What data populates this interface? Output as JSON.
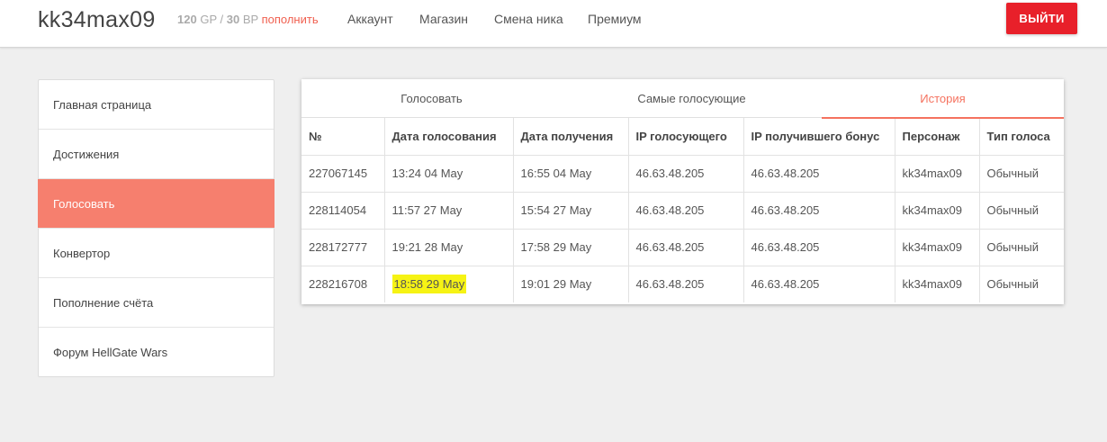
{
  "header": {
    "username": "kk34max09",
    "gp_value": "120",
    "gp_unit": "GP",
    "separator": "/",
    "bp_value": "30",
    "bp_unit": "BP",
    "topup_label": "пополнить",
    "nav": [
      "Аккаунт",
      "Магазин",
      "Смена ника",
      "Премиум"
    ],
    "logout_label": "ВЫЙТИ"
  },
  "sidebar": {
    "items": [
      {
        "label": "Главная страница",
        "active": false
      },
      {
        "label": "Достижения",
        "active": false
      },
      {
        "label": "Голосовать",
        "active": true
      },
      {
        "label": "Конвертор",
        "active": false
      },
      {
        "label": "Пополнение счёта",
        "active": false
      },
      {
        "label": "Форум HellGate Wars",
        "active": false
      }
    ]
  },
  "tabs": [
    {
      "label": "Голосовать",
      "active": false
    },
    {
      "label": "Самые голосующие",
      "active": false
    },
    {
      "label": "История",
      "active": true
    }
  ],
  "table": {
    "headers": [
      "№",
      "Дата голосования",
      "Дата получения",
      "IP голосующего",
      "IP получившего бонус",
      "Персонаж",
      "Тип голоса"
    ],
    "rows": [
      [
        "227067145",
        "13:24 04 May",
        "16:55 04 May",
        "46.63.48.205",
        "46.63.48.205",
        "kk34max09",
        "Обычный"
      ],
      [
        "228114054",
        "11:57 27 May",
        "15:54 27 May",
        "46.63.48.205",
        "46.63.48.205",
        "kk34max09",
        "Обычный"
      ],
      [
        "228172777",
        "19:21 28 May",
        "17:58 29 May",
        "46.63.48.205",
        "46.63.48.205",
        "kk34max09",
        "Обычный"
      ],
      [
        "228216708",
        "18:58 29 May",
        "19:01 29 May",
        "46.63.48.205",
        "46.63.48.205",
        "kk34max09",
        "Обычный"
      ]
    ],
    "highlighted_cell": {
      "row": 3,
      "col": 1,
      "color": "#f6f314"
    }
  },
  "colors": {
    "accent": "#f5725f",
    "active_sidebar": "#f67f6e",
    "logout": "#e8202a",
    "highlight": "#f6f314"
  }
}
